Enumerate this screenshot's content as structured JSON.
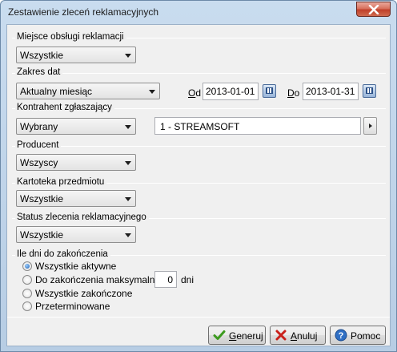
{
  "window": {
    "title": "Zestawienie zleceń reklamacyjnych"
  },
  "groups": {
    "service_location": {
      "label": "Miejsce obsługi reklamacji",
      "value": "Wszystkie"
    },
    "date_range": {
      "label": "Zakres dat",
      "value": "Aktualny miesiąc",
      "from_label_accel": "O",
      "from_label_rest": "d",
      "from_value": "2013-01-01",
      "to_label_accel": "D",
      "to_label_rest": "o",
      "to_value": "2013-01-31"
    },
    "reporting_contractor": {
      "label": "Kontrahent zgłaszający",
      "value": "Wybrany",
      "selected": "1 - STREAMSOFT"
    },
    "producer": {
      "label": "Producent",
      "value": "Wszyscy"
    },
    "item_card": {
      "label": "Kartoteka przedmiotu",
      "value": "Wszystkie"
    },
    "order_status": {
      "label": "Status zlecenia reklamacyjnego",
      "value": "Wszystkie"
    },
    "days_to_completion": {
      "label": "Ile dni do zakończenia",
      "options": [
        {
          "label": "Wszystkie aktywne",
          "checked": true
        },
        {
          "label": "Do zakończenia maksymalnie",
          "checked": false
        },
        {
          "label": "Wszystkie zakończone",
          "checked": false
        },
        {
          "label": "Przeterminowane",
          "checked": false
        }
      ],
      "max_days_value": "0",
      "days_unit": "dni"
    }
  },
  "buttons": {
    "generate": {
      "accel": "G",
      "rest": "eneruj"
    },
    "cancel": {
      "accel": "A",
      "rest": "nuluj"
    },
    "help": {
      "label": "Pomoc"
    }
  },
  "colors": {
    "title_bar": "#c9dcef",
    "close_button": "#c0402a",
    "client_bg": "#f0f0f0"
  }
}
